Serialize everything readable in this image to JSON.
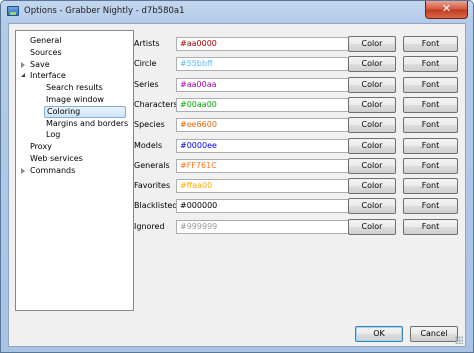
{
  "window": {
    "title": "Options - Grabber Nightly - d7b580a1",
    "close_glyph": "✕"
  },
  "tree": [
    {
      "label": "General",
      "expander": "none"
    },
    {
      "label": "Sources",
      "expander": "none"
    },
    {
      "label": "Save",
      "expander": "collapsed"
    },
    {
      "label": "Interface",
      "expander": "expanded"
    },
    {
      "label": "Search results",
      "expander": "none"
    },
    {
      "label": "Image window",
      "expander": "none"
    },
    {
      "label": "Coloring",
      "expander": "none",
      "selected": true
    },
    {
      "label": "Margins and borders",
      "expander": "none"
    },
    {
      "label": "Log",
      "expander": "none"
    },
    {
      "label": "Proxy",
      "expander": "none"
    },
    {
      "label": "Web services",
      "expander": "none"
    },
    {
      "label": "Commands",
      "expander": "collapsed"
    }
  ],
  "coloring_rows": [
    {
      "label": "Artists",
      "value": "#aa0000",
      "color": "#aa0000"
    },
    {
      "label": "Circle",
      "value": "#55bbff",
      "color": "#55bbff"
    },
    {
      "label": "Series",
      "value": "#aa00aa",
      "color": "#aa00aa"
    },
    {
      "label": "Characters",
      "value": "#00aa00",
      "color": "#00aa00"
    },
    {
      "label": "Species",
      "value": "#ee6600",
      "color": "#ee6600"
    },
    {
      "label": "Models",
      "value": "#0000ee",
      "color": "#0000ee"
    },
    {
      "label": "Generals",
      "value": "#FF761C",
      "color": "#FF761C"
    },
    {
      "label": "Favorites",
      "value": "#ffaa00",
      "color": "#ffaa00"
    },
    {
      "label": "Blacklisted",
      "value": "#000000",
      "color": "#000000"
    },
    {
      "label": "Ignored",
      "value": "#999999",
      "color": "#999999"
    }
  ],
  "buttons": {
    "color_label": "Color",
    "font_label": "Font",
    "ok_label": "OK",
    "cancel_label": "Cancel"
  }
}
